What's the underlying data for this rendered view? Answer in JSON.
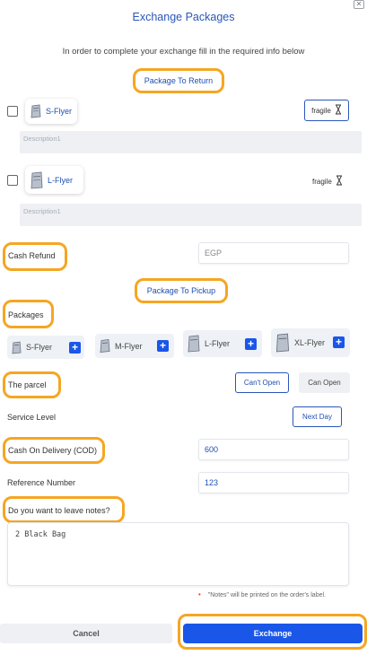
{
  "modal": {
    "title": "Exchange Packages",
    "close_icon": "close-icon",
    "subtitle": "In order to complete your exchange fill in the required info below"
  },
  "return_section": {
    "header": "Package To Return",
    "items": [
      {
        "name": "S-Flyer",
        "fragile_label": "fragile",
        "description_placeholder": "Description1",
        "checked": false,
        "fragile_active": true
      },
      {
        "name": "L-Flyer",
        "fragile_label": "fragile",
        "description_placeholder": "Description1",
        "checked": false,
        "fragile_active": false
      }
    ]
  },
  "cash_refund": {
    "label": "Cash Refund",
    "currency": "EGP"
  },
  "pickup_section": {
    "header": "Package To Pickup",
    "packages_label": "Packages",
    "packages": [
      "S-Flyer",
      "M-Flyer",
      "L-Flyer",
      "XL-Flyer"
    ]
  },
  "parcel": {
    "label": "The parcel",
    "options": [
      "Can't Open",
      "Can Open"
    ],
    "selected": "Can't Open"
  },
  "service_level": {
    "label": "Service Level",
    "value": "Next Day"
  },
  "cod": {
    "label": "Cash On Delivery (COD)",
    "value": "600"
  },
  "reference": {
    "label": "Reference Number",
    "value": "123"
  },
  "notes": {
    "label": "Do you want to leave notes?",
    "value": "2 Black Bag",
    "hint": "\"Notes\" will be printed on the order's label."
  },
  "footer": {
    "cancel_label": "Cancel",
    "exchange_label": "Exchange"
  },
  "colors": {
    "accent": "#1a56e8",
    "highlight": "#f5a623",
    "title": "#2a57b8"
  }
}
